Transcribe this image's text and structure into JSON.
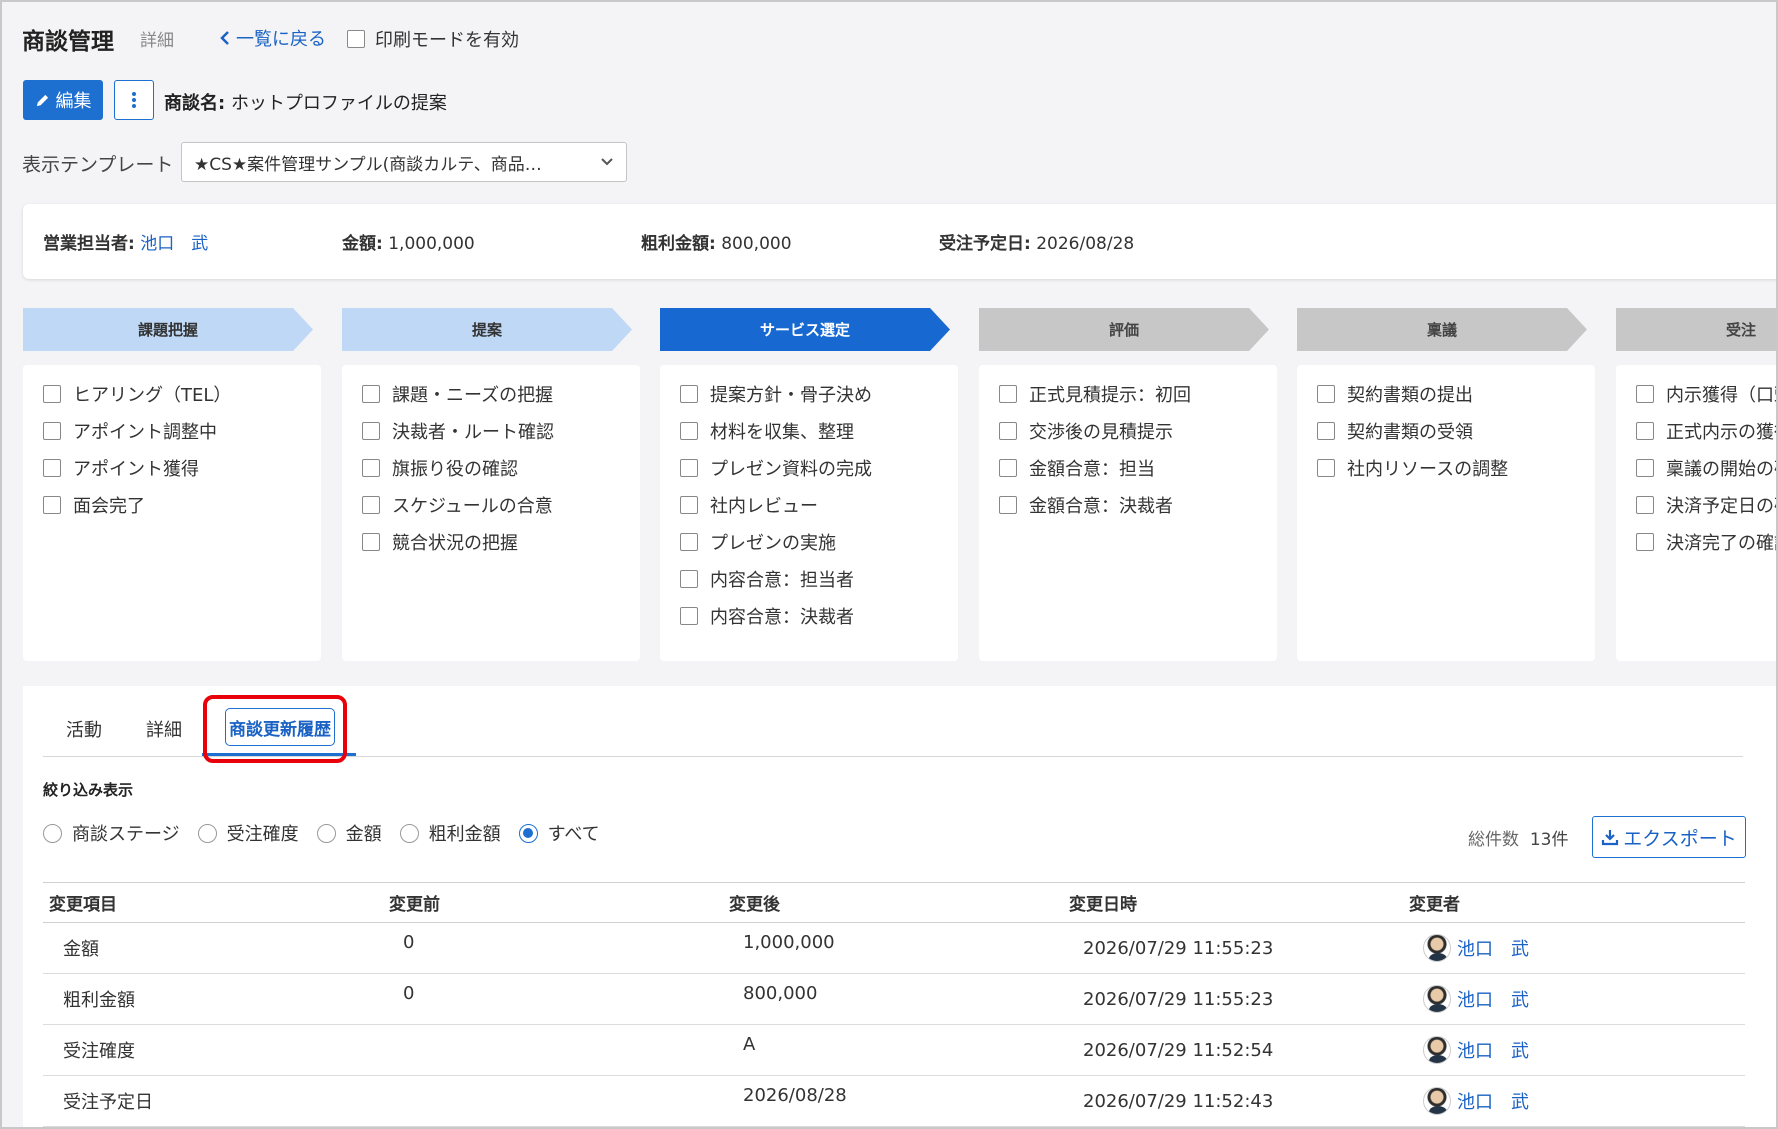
{
  "header": {
    "title": "商談管理",
    "subtitle": "詳細",
    "back_label": "一覧に戻る",
    "print_label": "印刷モードを有効"
  },
  "toolbar": {
    "edit_label": "編集",
    "more_icon": "kebab-icon",
    "deal_label": "商談名:",
    "deal_name": "ホットプロファイルの提案"
  },
  "template": {
    "label": "表示テンプレート",
    "selected": "★CS★案件管理サンプル(商談カルテ、商品…"
  },
  "summary": {
    "owner_label": "営業担当者:",
    "owner_name": "池口　武",
    "amount_label": "金額:",
    "amount": "1,000,000",
    "profit_label": "粗利金額:",
    "profit": "800,000",
    "date_label": "受注予定日:",
    "date": "2026/08/28"
  },
  "stages": [
    {
      "label": "課題把握",
      "state": "done",
      "tasks": [
        "ヒアリング（TEL）",
        "アポイント調整中",
        "アポイント獲得",
        "面会完了"
      ]
    },
    {
      "label": "提案",
      "state": "done",
      "tasks": [
        "課題・ニーズの把握",
        "決裁者・ルート確認",
        "旗振り役の確認",
        "スケジュールの合意",
        "競合状況の把握"
      ]
    },
    {
      "label": "サービス選定",
      "state": "active",
      "tasks": [
        "提案方針・骨子決め",
        "材料を収集、整理",
        "プレゼン資料の完成",
        "社内レビュー",
        "プレゼンの実施",
        "内容合意：担当者",
        "内容合意：決裁者"
      ]
    },
    {
      "label": "評価",
      "state": "todo",
      "tasks": [
        "正式見積提示：初回",
        "交渉後の見積提示",
        "金額合意：担当",
        "金額合意：決裁者"
      ]
    },
    {
      "label": "稟議",
      "state": "todo",
      "tasks": [
        "契約書類の提出",
        "契約書類の受領",
        "社内リソースの調整"
      ]
    },
    {
      "label": "受注",
      "state": "todo",
      "tasks": [
        "内示獲得（口頭",
        "正式内示の獲得",
        "稟議の開始の確",
        "決済予定日の確",
        "決済完了の確認"
      ]
    }
  ],
  "tabs": [
    "活動",
    "詳細",
    "商談更新履歴"
  ],
  "filter": {
    "title": "絞り込み表示",
    "options": [
      "商談ステージ",
      "受注確度",
      "金額",
      "粗利金額",
      "すべて"
    ],
    "selected": "すべて"
  },
  "count_label": "総件数",
  "count_value": "13件",
  "export_label": "エクスポート",
  "table": {
    "headers": [
      "変更項目",
      "変更前",
      "変更後",
      "変更日時",
      "変更者"
    ],
    "rows": [
      {
        "item": "金額",
        "before": "0",
        "after": "1,000,000",
        "datetime": "2026/07/29 11:55:23",
        "user": "池口　武"
      },
      {
        "item": "粗利金額",
        "before": "0",
        "after": "800,000",
        "datetime": "2026/07/29 11:55:23",
        "user": "池口　武"
      },
      {
        "item": "受注確度",
        "before": "",
        "after": "A",
        "datetime": "2026/07/29 11:52:54",
        "user": "池口　武"
      },
      {
        "item": "受注予定日",
        "before": "",
        "after": "2026/08/28",
        "datetime": "2026/07/29 11:52:43",
        "user": "池口　武"
      }
    ]
  },
  "colors": {
    "accent": "#1d6fd0",
    "highlight": "#e8000b",
    "stage_done": "#bed8f6",
    "stage_todo": "#c7c7c7"
  }
}
